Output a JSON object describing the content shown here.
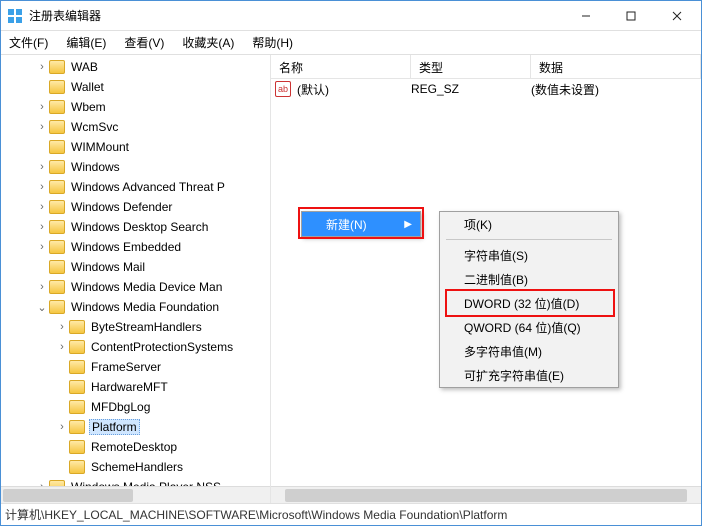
{
  "title": "注册表编辑器",
  "menubar": [
    "文件(F)",
    "编辑(E)",
    "查看(V)",
    "收藏夹(A)",
    "帮助(H)"
  ],
  "tree": [
    {
      "ind": 1,
      "exp": ">",
      "label": "WAB"
    },
    {
      "ind": 1,
      "exp": "",
      "label": "Wallet"
    },
    {
      "ind": 1,
      "exp": ">",
      "label": "Wbem"
    },
    {
      "ind": 1,
      "exp": ">",
      "label": "WcmSvc"
    },
    {
      "ind": 1,
      "exp": "",
      "label": "WIMMount"
    },
    {
      "ind": 1,
      "exp": ">",
      "label": "Windows"
    },
    {
      "ind": 1,
      "exp": ">",
      "label": "Windows Advanced Threat P"
    },
    {
      "ind": 1,
      "exp": ">",
      "label": "Windows Defender"
    },
    {
      "ind": 1,
      "exp": ">",
      "label": "Windows Desktop Search"
    },
    {
      "ind": 1,
      "exp": ">",
      "label": "Windows Embedded"
    },
    {
      "ind": 1,
      "exp": "",
      "label": "Windows Mail"
    },
    {
      "ind": 1,
      "exp": ">",
      "label": "Windows Media Device Man"
    },
    {
      "ind": 1,
      "exp": "v",
      "label": "Windows Media Foundation"
    },
    {
      "ind": 2,
      "exp": ">",
      "label": "ByteStreamHandlers"
    },
    {
      "ind": 2,
      "exp": ">",
      "label": "ContentProtectionSystems"
    },
    {
      "ind": 2,
      "exp": "",
      "label": "FrameServer"
    },
    {
      "ind": 2,
      "exp": "",
      "label": "HardwareMFT"
    },
    {
      "ind": 2,
      "exp": "",
      "label": "MFDbgLog"
    },
    {
      "ind": 2,
      "exp": ">",
      "label": "Platform",
      "sel": true
    },
    {
      "ind": 2,
      "exp": "",
      "label": "RemoteDesktop"
    },
    {
      "ind": 2,
      "exp": "",
      "label": "SchemeHandlers"
    },
    {
      "ind": 1,
      "exp": ">",
      "label": "Windows Media Player NSS"
    }
  ],
  "list": {
    "headers": {
      "name": "名称",
      "type": "类型",
      "data": "数据"
    },
    "rows": [
      {
        "icon": "ab",
        "name": "(默认)",
        "type": "REG_SZ",
        "data": "(数值未设置)"
      }
    ]
  },
  "context": {
    "main": {
      "label": "新建(N)"
    },
    "sub": [
      {
        "label": "项(K)"
      },
      {
        "sep": true
      },
      {
        "label": "字符串值(S)"
      },
      {
        "label": "二进制值(B)"
      },
      {
        "label": "DWORD (32 位)值(D)",
        "hl": true
      },
      {
        "label": "QWORD (64 位)值(Q)"
      },
      {
        "label": "多字符串值(M)"
      },
      {
        "label": "可扩充字符串值(E)"
      }
    ]
  },
  "status": "计算机\\HKEY_LOCAL_MACHINE\\SOFTWARE\\Microsoft\\Windows Media Foundation\\Platform"
}
